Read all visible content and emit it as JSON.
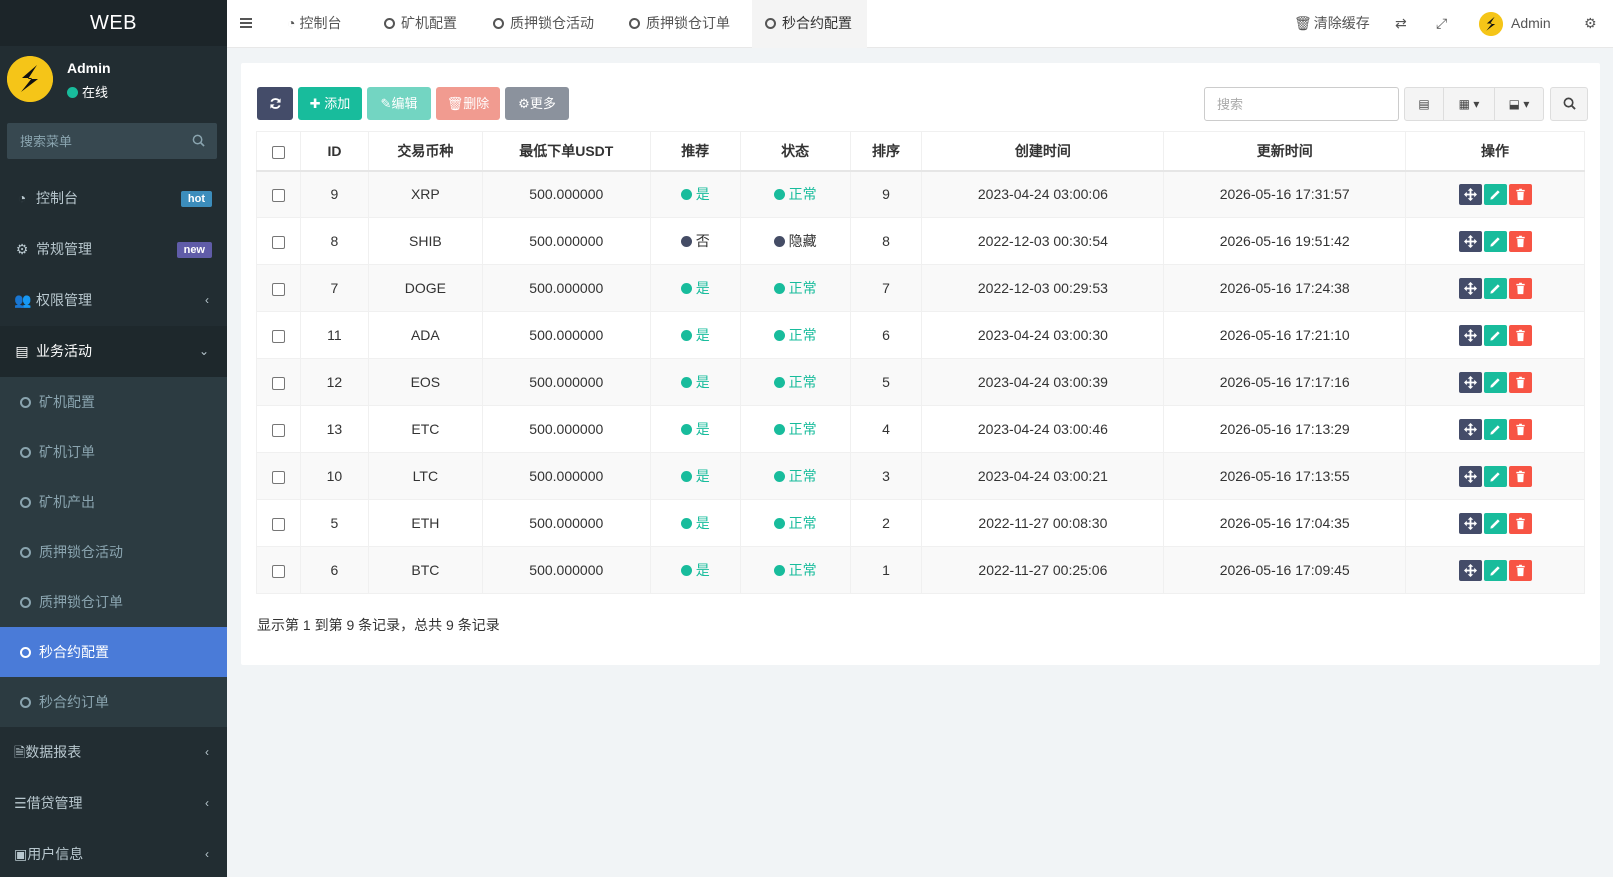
{
  "app": {
    "title": "WEB"
  },
  "user": {
    "name": "Admin",
    "status": "在线"
  },
  "sidebar": {
    "search_placeholder": "搜索菜单",
    "items": [
      {
        "label": "控制台",
        "badge": "hot"
      },
      {
        "label": "常规管理",
        "badge": "new"
      },
      {
        "label": "权限管理"
      },
      {
        "label": "业务活动"
      }
    ],
    "sub_items": [
      "矿机配置",
      "矿机订单",
      "矿机产出",
      "质押锁仓活动",
      "质押锁仓订单",
      "秒合约配置",
      "秒合约订单"
    ],
    "bottom_items": [
      {
        "label": "数据报表"
      },
      {
        "label": "借贷管理"
      },
      {
        "label": "用户信息"
      }
    ]
  },
  "header": {
    "tabs": [
      "控制台",
      "矿机配置",
      "质押锁仓活动",
      "质押锁仓订单",
      "秒合约配置"
    ],
    "clear_cache": "清除缓存",
    "admin": "Admin"
  },
  "toolbar": {
    "add": "添加",
    "edit": "编辑",
    "delete": "删除",
    "more": "更多",
    "search_placeholder": "搜索"
  },
  "table": {
    "columns": [
      "ID",
      "交易币种",
      "最低下单USDT",
      "推荐",
      "状态",
      "排序",
      "创建时间",
      "更新时间",
      "操作"
    ],
    "rows": [
      {
        "id": "9",
        "coin": "XRP",
        "min": "500.000000",
        "rec": "是",
        "status": "正常",
        "sort": "9",
        "created": "2023-04-24 03:00:06",
        "updated": "2026-05-16 17:31:57"
      },
      {
        "id": "8",
        "coin": "SHIB",
        "min": "500.000000",
        "rec": "否",
        "status": "隐藏",
        "sort": "8",
        "created": "2022-12-03 00:30:54",
        "updated": "2026-05-16 19:51:42"
      },
      {
        "id": "7",
        "coin": "DOGE",
        "min": "500.000000",
        "rec": "是",
        "status": "正常",
        "sort": "7",
        "created": "2022-12-03 00:29:53",
        "updated": "2026-05-16 17:24:38"
      },
      {
        "id": "11",
        "coin": "ADA",
        "min": "500.000000",
        "rec": "是",
        "status": "正常",
        "sort": "6",
        "created": "2023-04-24 03:00:30",
        "updated": "2026-05-16 17:21:10"
      },
      {
        "id": "12",
        "coin": "EOS",
        "min": "500.000000",
        "rec": "是",
        "status": "正常",
        "sort": "5",
        "created": "2023-04-24 03:00:39",
        "updated": "2026-05-16 17:17:16"
      },
      {
        "id": "13",
        "coin": "ETC",
        "min": "500.000000",
        "rec": "是",
        "status": "正常",
        "sort": "4",
        "created": "2023-04-24 03:00:46",
        "updated": "2026-05-16 17:13:29"
      },
      {
        "id": "10",
        "coin": "LTC",
        "min": "500.000000",
        "rec": "是",
        "status": "正常",
        "sort": "3",
        "created": "2023-04-24 03:00:21",
        "updated": "2026-05-16 17:13:55"
      },
      {
        "id": "5",
        "coin": "ETH",
        "min": "500.000000",
        "rec": "是",
        "status": "正常",
        "sort": "2",
        "created": "2022-11-27 00:08:30",
        "updated": "2026-05-16 17:04:35"
      },
      {
        "id": "6",
        "coin": "BTC",
        "min": "500.000000",
        "rec": "是",
        "status": "正常",
        "sort": "1",
        "created": "2022-11-27 00:25:06",
        "updated": "2026-05-16 17:09:45"
      }
    ]
  },
  "summary": "显示第 1 到第 9 条记录，总共 9 条记录",
  "colors": {
    "accent": "#18bc9c",
    "sidebar": "#222d32",
    "active": "#4a7bd8",
    "danger": "#f75444",
    "dark_button": "#444c69"
  }
}
